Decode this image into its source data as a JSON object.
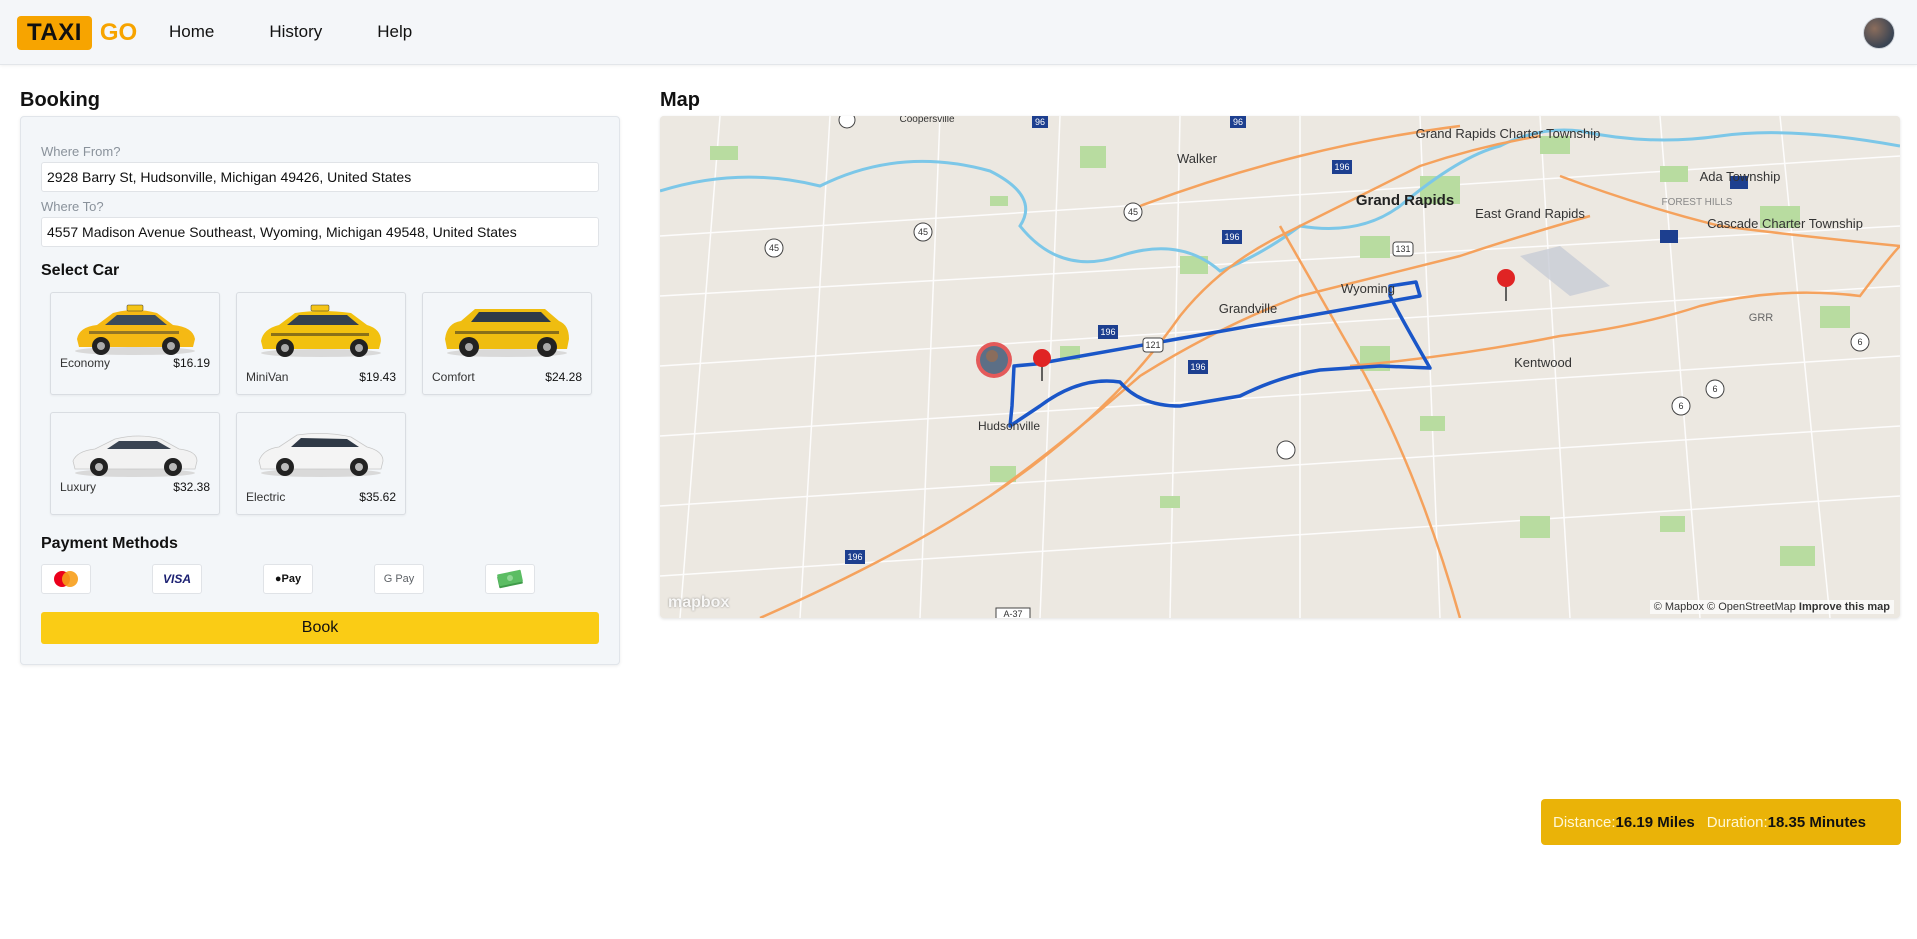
{
  "header": {
    "logo_taxi": "TAXI",
    "logo_go": "GO",
    "nav": [
      "Home",
      "History",
      "Help"
    ],
    "avatar_icon": "user-avatar-icon"
  },
  "booking": {
    "title": "Booking",
    "from_label": "Where From?",
    "from_value": "2928 Barry St, Hudsonville, Michigan 49426, United States",
    "to_label": "Where To?",
    "to_value": "4557 Madison Avenue Southeast, Wyoming, Michigan 49548, United States",
    "select_car_title": "Select Car",
    "cars": [
      {
        "name": "Economy",
        "price": "$16.19",
        "color": "#f5c518"
      },
      {
        "name": "MiniVan",
        "price": "$19.43",
        "color": "#f5c518"
      },
      {
        "name": "Comfort",
        "price": "$24.28",
        "color": "#f5c518"
      },
      {
        "name": "Luxury",
        "price": "$32.38",
        "color": "#f2f2f2"
      },
      {
        "name": "Electric",
        "price": "$35.62",
        "color": "#f2f2f2"
      }
    ],
    "payment_title": "Payment Methods",
    "payment_methods": [
      "mastercard-icon",
      "VISA",
      "Pay",
      "G Pay",
      "cash-icon"
    ],
    "book_label": "Book"
  },
  "map": {
    "title": "Map",
    "places": [
      "Coopersville",
      "Walker",
      "Grand Rapids",
      "Grand Rapids Charter Township",
      "Ada Township",
      "FOREST HILLS",
      "East Grand Rapids",
      "Cascade Charter Township",
      "GRR",
      "Wyoming",
      "Grandville",
      "Kentwood",
      "Hudsonville"
    ],
    "shields": [
      "45",
      "45",
      "45",
      "96",
      "96",
      "196",
      "196",
      "196",
      "196",
      "131",
      "121",
      "6",
      "6",
      "6",
      "196",
      "A-37"
    ],
    "logo": "mapbox",
    "attribution": "© Mapbox © OpenStreetMap",
    "improve_link": "Improve this map",
    "route_color": "#1a56c8"
  },
  "trip": {
    "distance_label": "Distance:",
    "distance_value": "16.19 Miles",
    "duration_label": "Duration:",
    "duration_value": "18.35 Minutes"
  },
  "colors": {
    "accent": "#facc15",
    "brand": "#f7a400",
    "info_badge": "#eab308"
  }
}
